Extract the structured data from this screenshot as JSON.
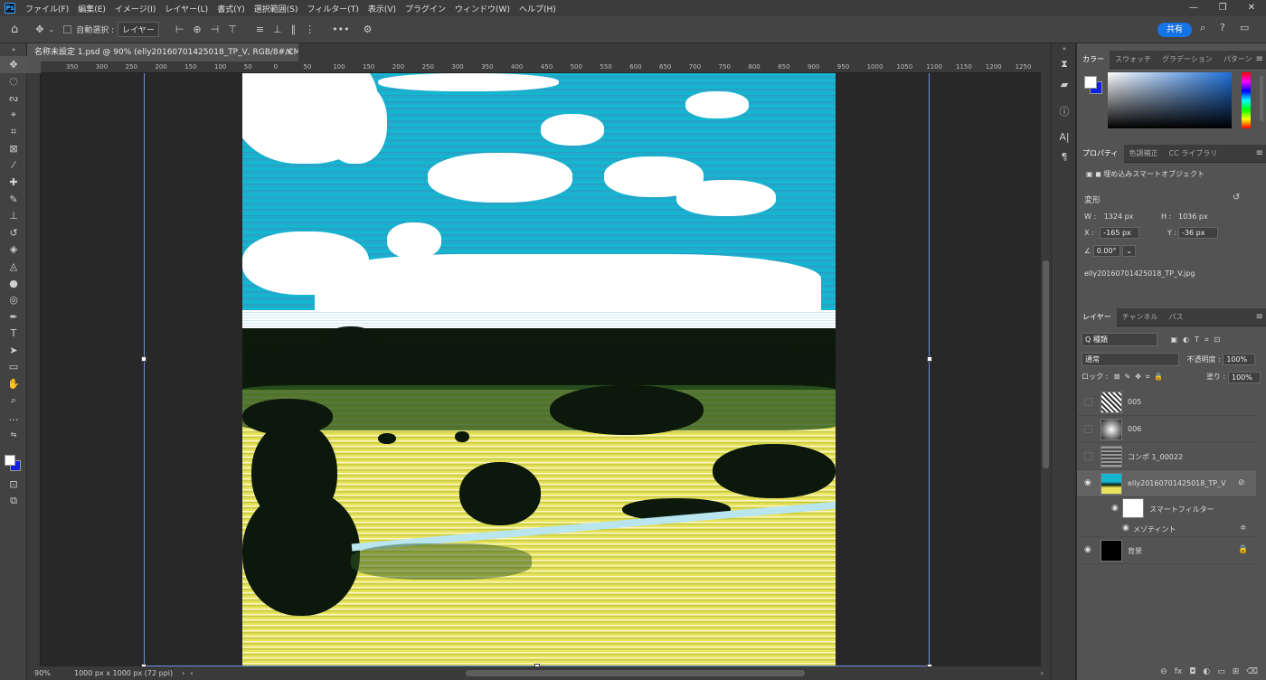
{
  "app": {
    "logo": "Ps"
  },
  "menu": [
    "ファイル(F)",
    "編集(E)",
    "イメージ(I)",
    "レイヤー(L)",
    "書式(Y)",
    "選択範囲(S)",
    "フィルター(T)",
    "表示(V)",
    "プラグイン",
    "ウィンドウ(W)",
    "ヘルプ(H)"
  ],
  "window_controls": [
    "—",
    "❐",
    "✕"
  ],
  "options": {
    "auto_select_label": "自動選択 :",
    "layer_dropdown": "レイヤー",
    "share_label": "共有"
  },
  "document": {
    "tab_title": "名称未設定 1.psd @ 90% (elly20160701425018_TP_V, RGB/8#/CMYK) *",
    "close": "×"
  },
  "ruler": {
    "h": [
      "350",
      "300",
      "250",
      "200",
      "150",
      "100",
      "50",
      "0",
      "50",
      "100",
      "150",
      "200",
      "250",
      "300",
      "350",
      "400",
      "450",
      "500",
      "550",
      "600",
      "650",
      "700",
      "750",
      "800",
      "850",
      "900",
      "950",
      "1000",
      "1050",
      "1100",
      "1150",
      "1200",
      "1250",
      "1300"
    ]
  },
  "status": {
    "zoom": "90%",
    "doc_size": "1000 px x 1000 px (72 ppi)"
  },
  "color_panel": {
    "tabs": [
      "カラー",
      "スウォッチ",
      "グラデーション",
      "パターン"
    ]
  },
  "properties": {
    "tabs": [
      "プロパティ",
      "色調補正",
      "CC ライブラリ"
    ],
    "type": "埋め込みスマートオブジェクト",
    "section": "変形",
    "w_label": "W :",
    "w": "1324 px",
    "h_label": "H :",
    "h": "1036 px",
    "x_label": "X :",
    "x": "-165 px",
    "y_label": "Y :",
    "y": "-36 px",
    "angle": "0.00°",
    "file": "elly20160701425018_TP_V.jpg"
  },
  "layers_panel": {
    "tabs": [
      "レイヤー",
      "チャンネル",
      "パス"
    ],
    "filter": "Q 種類",
    "blend": "通常",
    "opacity_label": "不透明度 :",
    "opacity": "100%",
    "lock_label": "ロック :",
    "fill_label": "塗り :",
    "fill": "100%",
    "layers": [
      {
        "name": "005",
        "visible": false
      },
      {
        "name": "006",
        "visible": false
      },
      {
        "name": "コンポ 1_00022",
        "visible": false
      },
      {
        "name": "elly20160701425018_TP_V",
        "visible": true
      },
      {
        "name": "スマートフィルター",
        "visible": true
      },
      {
        "name": "メゾティント",
        "visible": true
      },
      {
        "name": "背景",
        "visible": true
      }
    ]
  },
  "colors": {
    "accent": "#1473e6",
    "fg_swatch": "#ffffff",
    "bg_swatch": "#1020e0"
  }
}
